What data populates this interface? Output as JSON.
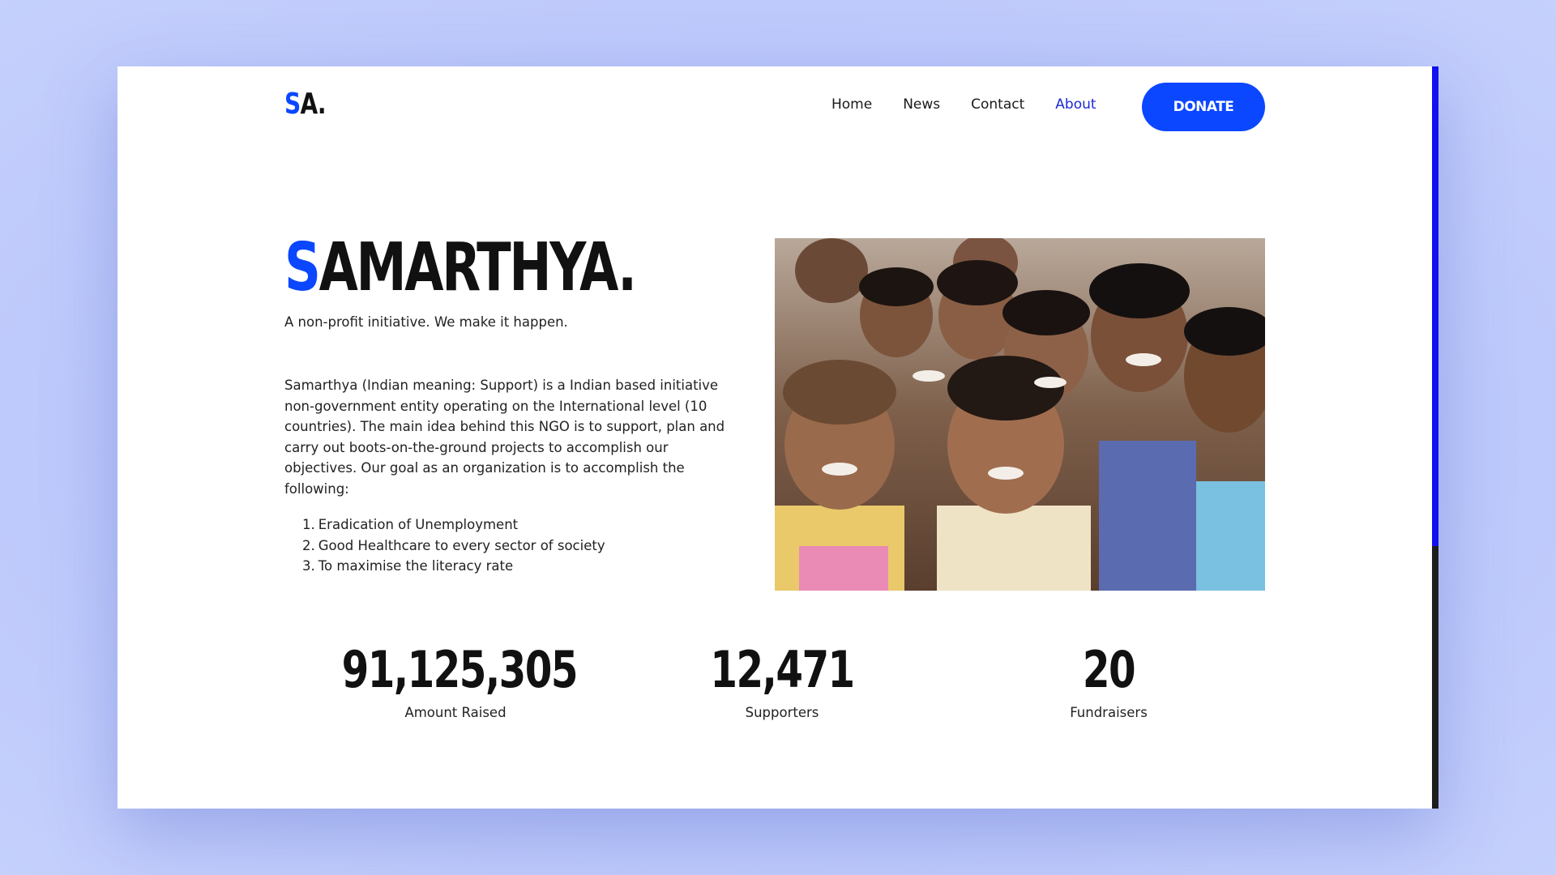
{
  "header": {
    "logo": {
      "accent": "S",
      "rest": "A."
    },
    "nav": [
      "Home",
      "News",
      "Contact",
      "About"
    ],
    "active_nav": "About",
    "donate_label": "DONATE"
  },
  "hero": {
    "title_accent": "S",
    "title_rest": "AMARTHYA.",
    "tagline": "A non-profit initiative. We make it happen.",
    "description": "Samarthya (Indian meaning: Support) is a Indian based initiative non-government entity operating on the International level (10 countries). The main idea behind this NGO is to support, plan and carry out boots-on-the-ground projects to accomplish our objectives. Our goal as an organization is to accomplish the following:",
    "goals": [
      "Eradication of Unemployment",
      "Good Healthcare to every sector of society",
      "To maximise the literacy rate"
    ],
    "photo_icon": "group-of-smiling-children-photo"
  },
  "stats": [
    {
      "value": "91,125,305",
      "label": "Amount Raised"
    },
    {
      "value": "12,471",
      "label": "Supporters"
    },
    {
      "value": "20",
      "label": "Fundraisers"
    }
  ],
  "colors": {
    "accent": "#0a47ff",
    "nav_active": "#1a2bd6",
    "scrollbar_thumb": "#1010f0",
    "background": "#bcc8fb"
  }
}
